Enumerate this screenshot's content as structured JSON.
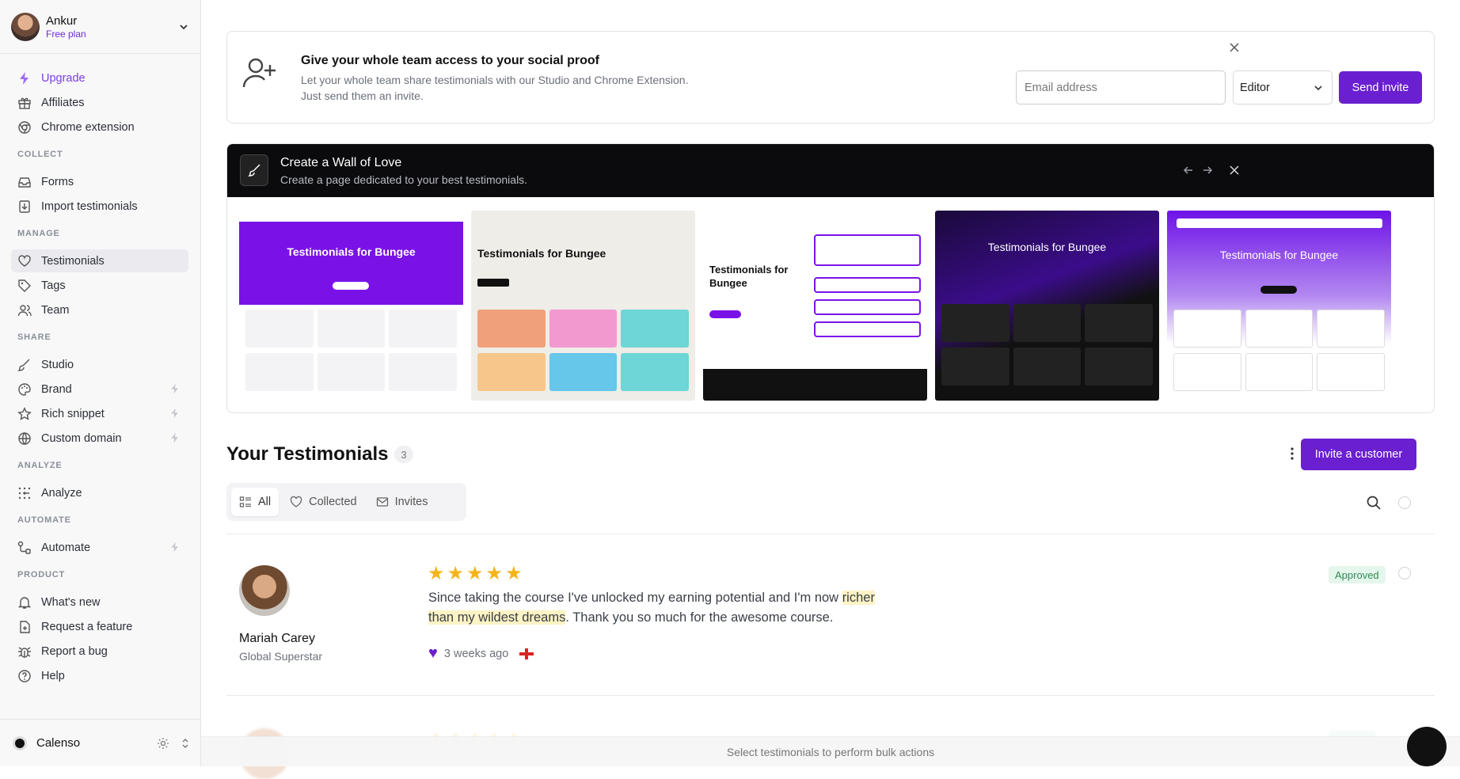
{
  "user": {
    "name": "Ankur",
    "plan": "Free plan"
  },
  "sidebar": {
    "top": [
      {
        "label": "Upgrade",
        "icon": "bolt-icon"
      },
      {
        "label": "Affiliates",
        "icon": "gift-icon"
      },
      {
        "label": "Chrome extension",
        "icon": "chrome-icon"
      }
    ],
    "collect": {
      "heading": "COLLECT",
      "items": [
        {
          "label": "Forms"
        },
        {
          "label": "Import testimonials"
        }
      ]
    },
    "manage": {
      "heading": "MANAGE",
      "items": [
        {
          "label": "Testimonials"
        },
        {
          "label": "Tags"
        },
        {
          "label": "Team"
        }
      ]
    },
    "share": {
      "heading": "SHARE",
      "items": [
        {
          "label": "Studio"
        },
        {
          "label": "Brand"
        },
        {
          "label": "Rich snippet"
        },
        {
          "label": "Custom domain"
        }
      ]
    },
    "analyze": {
      "heading": "ANALYZE",
      "items": [
        {
          "label": "Analyze"
        }
      ]
    },
    "automate": {
      "heading": "AUTOMATE",
      "items": [
        {
          "label": "Automate"
        }
      ]
    },
    "product": {
      "heading": "PRODUCT",
      "items": [
        {
          "label": "What's new"
        },
        {
          "label": "Request a feature"
        },
        {
          "label": "Report a bug"
        },
        {
          "label": "Help"
        }
      ]
    },
    "workspace": "Calenso"
  },
  "invite": {
    "title": "Give your whole team access to your social proof",
    "desc1": "Let your whole team share testimonials with our Studio and Chrome Extension.",
    "desc2": "Just send them an invite.",
    "email_placeholder": "Email address",
    "role": "Editor",
    "send": "Send invite"
  },
  "wall": {
    "title": "Create a Wall of Love",
    "subtitle": "Create a page dedicated to your best testimonials.",
    "thumb_title": "Testimonials for Bungee",
    "thumb_title_split": [
      "Testimonials for",
      "Bungee"
    ]
  },
  "testimonials": {
    "heading": "Your Testimonials",
    "count": "3",
    "invite_customer": "Invite a customer",
    "filters": [
      "All",
      "Collected",
      "Invites"
    ],
    "items": [
      {
        "name": "Mariah Carey",
        "role": "Global Superstar",
        "rating": 5,
        "text_before": "Since taking the course I've unlocked my earning potential and I'm now ",
        "text_highlight": "richer than my wildest dreams",
        "text_after": ". Thank you so much for the awesome course.",
        "time": "3 weeks ago",
        "status": "Approved"
      }
    ]
  },
  "bulk": "Select testimonials to perform bulk actions",
  "colors": {
    "accent": "#6a1fd0",
    "approved_bg": "#e5f6ec",
    "star": "#f5b41a"
  }
}
